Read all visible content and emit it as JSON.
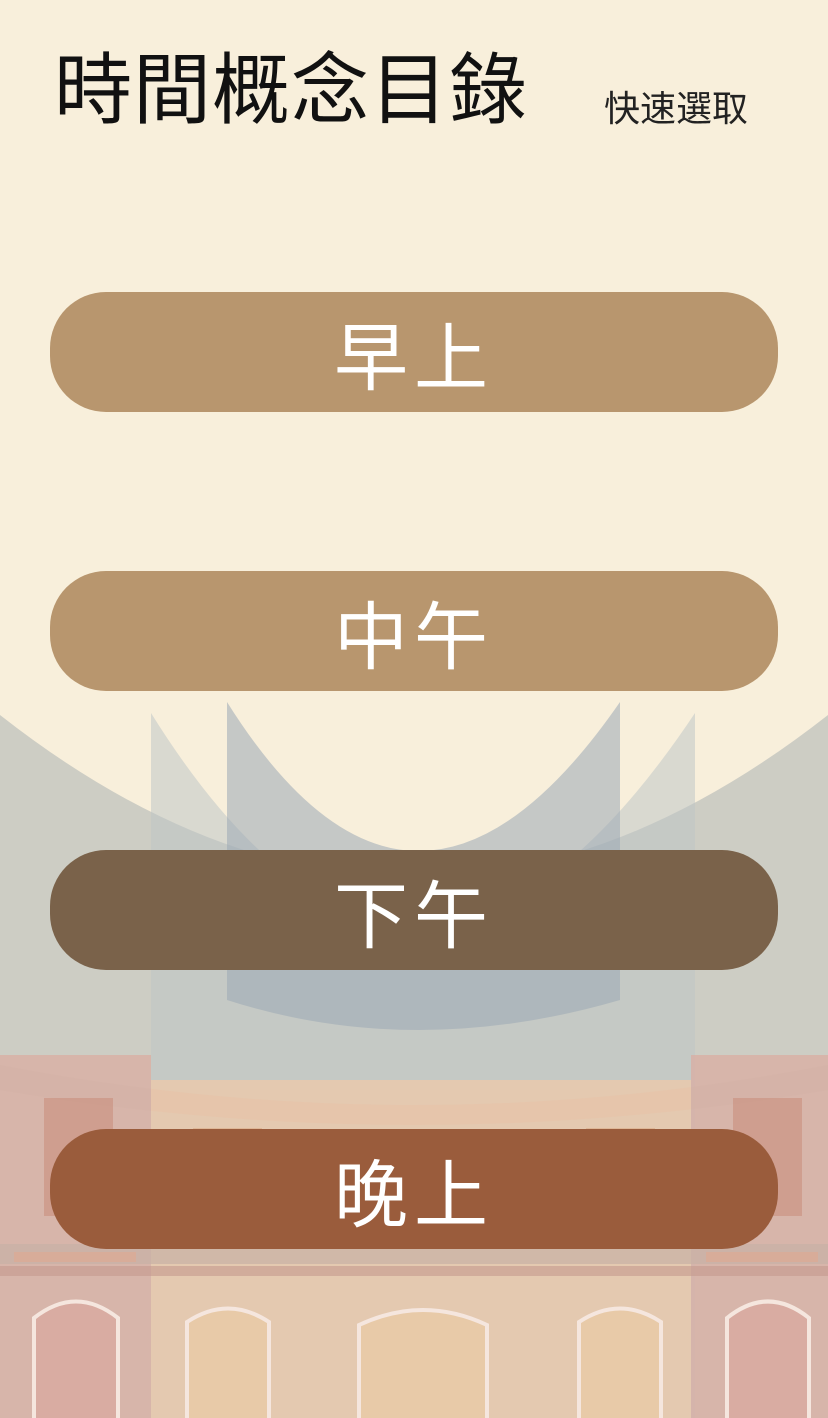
{
  "header": {
    "title": "時間概念目錄",
    "quick_select_label": "快速選取"
  },
  "time_buttons": [
    {
      "label": "早上",
      "color": "#b8966e"
    },
    {
      "label": "中午",
      "color": "#b8966e"
    },
    {
      "label": "下午",
      "color": "#7a624a"
    },
    {
      "label": "晚上",
      "color": "#9a5c3c"
    }
  ],
  "colors": {
    "background": "#f8efdb",
    "title_text": "#111111",
    "button_text": "#ffffff",
    "drape_grey": "#b0b6b4",
    "building_pink": "#d9aca2",
    "building_peach": "#eec8a8"
  }
}
